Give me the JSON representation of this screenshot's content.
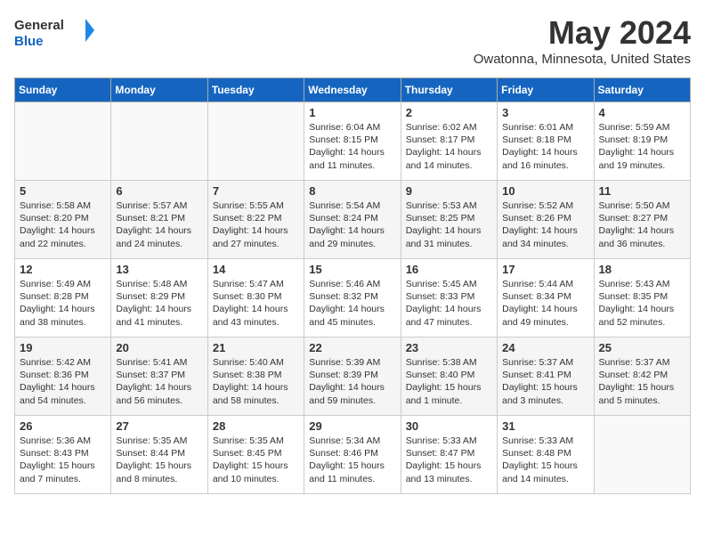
{
  "header": {
    "logo_general": "General",
    "logo_blue": "Blue",
    "month_title": "May 2024",
    "location": "Owatonna, Minnesota, United States"
  },
  "days_of_week": [
    "Sunday",
    "Monday",
    "Tuesday",
    "Wednesday",
    "Thursday",
    "Friday",
    "Saturday"
  ],
  "weeks": [
    [
      {
        "day": "",
        "info": ""
      },
      {
        "day": "",
        "info": ""
      },
      {
        "day": "",
        "info": ""
      },
      {
        "day": "1",
        "info": "Sunrise: 6:04 AM\nSunset: 8:15 PM\nDaylight: 14 hours\nand 11 minutes."
      },
      {
        "day": "2",
        "info": "Sunrise: 6:02 AM\nSunset: 8:17 PM\nDaylight: 14 hours\nand 14 minutes."
      },
      {
        "day": "3",
        "info": "Sunrise: 6:01 AM\nSunset: 8:18 PM\nDaylight: 14 hours\nand 16 minutes."
      },
      {
        "day": "4",
        "info": "Sunrise: 5:59 AM\nSunset: 8:19 PM\nDaylight: 14 hours\nand 19 minutes."
      }
    ],
    [
      {
        "day": "5",
        "info": "Sunrise: 5:58 AM\nSunset: 8:20 PM\nDaylight: 14 hours\nand 22 minutes."
      },
      {
        "day": "6",
        "info": "Sunrise: 5:57 AM\nSunset: 8:21 PM\nDaylight: 14 hours\nand 24 minutes."
      },
      {
        "day": "7",
        "info": "Sunrise: 5:55 AM\nSunset: 8:22 PM\nDaylight: 14 hours\nand 27 minutes."
      },
      {
        "day": "8",
        "info": "Sunrise: 5:54 AM\nSunset: 8:24 PM\nDaylight: 14 hours\nand 29 minutes."
      },
      {
        "day": "9",
        "info": "Sunrise: 5:53 AM\nSunset: 8:25 PM\nDaylight: 14 hours\nand 31 minutes."
      },
      {
        "day": "10",
        "info": "Sunrise: 5:52 AM\nSunset: 8:26 PM\nDaylight: 14 hours\nand 34 minutes."
      },
      {
        "day": "11",
        "info": "Sunrise: 5:50 AM\nSunset: 8:27 PM\nDaylight: 14 hours\nand 36 minutes."
      }
    ],
    [
      {
        "day": "12",
        "info": "Sunrise: 5:49 AM\nSunset: 8:28 PM\nDaylight: 14 hours\nand 38 minutes."
      },
      {
        "day": "13",
        "info": "Sunrise: 5:48 AM\nSunset: 8:29 PM\nDaylight: 14 hours\nand 41 minutes."
      },
      {
        "day": "14",
        "info": "Sunrise: 5:47 AM\nSunset: 8:30 PM\nDaylight: 14 hours\nand 43 minutes."
      },
      {
        "day": "15",
        "info": "Sunrise: 5:46 AM\nSunset: 8:32 PM\nDaylight: 14 hours\nand 45 minutes."
      },
      {
        "day": "16",
        "info": "Sunrise: 5:45 AM\nSunset: 8:33 PM\nDaylight: 14 hours\nand 47 minutes."
      },
      {
        "day": "17",
        "info": "Sunrise: 5:44 AM\nSunset: 8:34 PM\nDaylight: 14 hours\nand 49 minutes."
      },
      {
        "day": "18",
        "info": "Sunrise: 5:43 AM\nSunset: 8:35 PM\nDaylight: 14 hours\nand 52 minutes."
      }
    ],
    [
      {
        "day": "19",
        "info": "Sunrise: 5:42 AM\nSunset: 8:36 PM\nDaylight: 14 hours\nand 54 minutes."
      },
      {
        "day": "20",
        "info": "Sunrise: 5:41 AM\nSunset: 8:37 PM\nDaylight: 14 hours\nand 56 minutes."
      },
      {
        "day": "21",
        "info": "Sunrise: 5:40 AM\nSunset: 8:38 PM\nDaylight: 14 hours\nand 58 minutes."
      },
      {
        "day": "22",
        "info": "Sunrise: 5:39 AM\nSunset: 8:39 PM\nDaylight: 14 hours\nand 59 minutes."
      },
      {
        "day": "23",
        "info": "Sunrise: 5:38 AM\nSunset: 8:40 PM\nDaylight: 15 hours\nand 1 minute."
      },
      {
        "day": "24",
        "info": "Sunrise: 5:37 AM\nSunset: 8:41 PM\nDaylight: 15 hours\nand 3 minutes."
      },
      {
        "day": "25",
        "info": "Sunrise: 5:37 AM\nSunset: 8:42 PM\nDaylight: 15 hours\nand 5 minutes."
      }
    ],
    [
      {
        "day": "26",
        "info": "Sunrise: 5:36 AM\nSunset: 8:43 PM\nDaylight: 15 hours\nand 7 minutes."
      },
      {
        "day": "27",
        "info": "Sunrise: 5:35 AM\nSunset: 8:44 PM\nDaylight: 15 hours\nand 8 minutes."
      },
      {
        "day": "28",
        "info": "Sunrise: 5:35 AM\nSunset: 8:45 PM\nDaylight: 15 hours\nand 10 minutes."
      },
      {
        "day": "29",
        "info": "Sunrise: 5:34 AM\nSunset: 8:46 PM\nDaylight: 15 hours\nand 11 minutes."
      },
      {
        "day": "30",
        "info": "Sunrise: 5:33 AM\nSunset: 8:47 PM\nDaylight: 15 hours\nand 13 minutes."
      },
      {
        "day": "31",
        "info": "Sunrise: 5:33 AM\nSunset: 8:48 PM\nDaylight: 15 hours\nand 14 minutes."
      },
      {
        "day": "",
        "info": ""
      }
    ]
  ]
}
